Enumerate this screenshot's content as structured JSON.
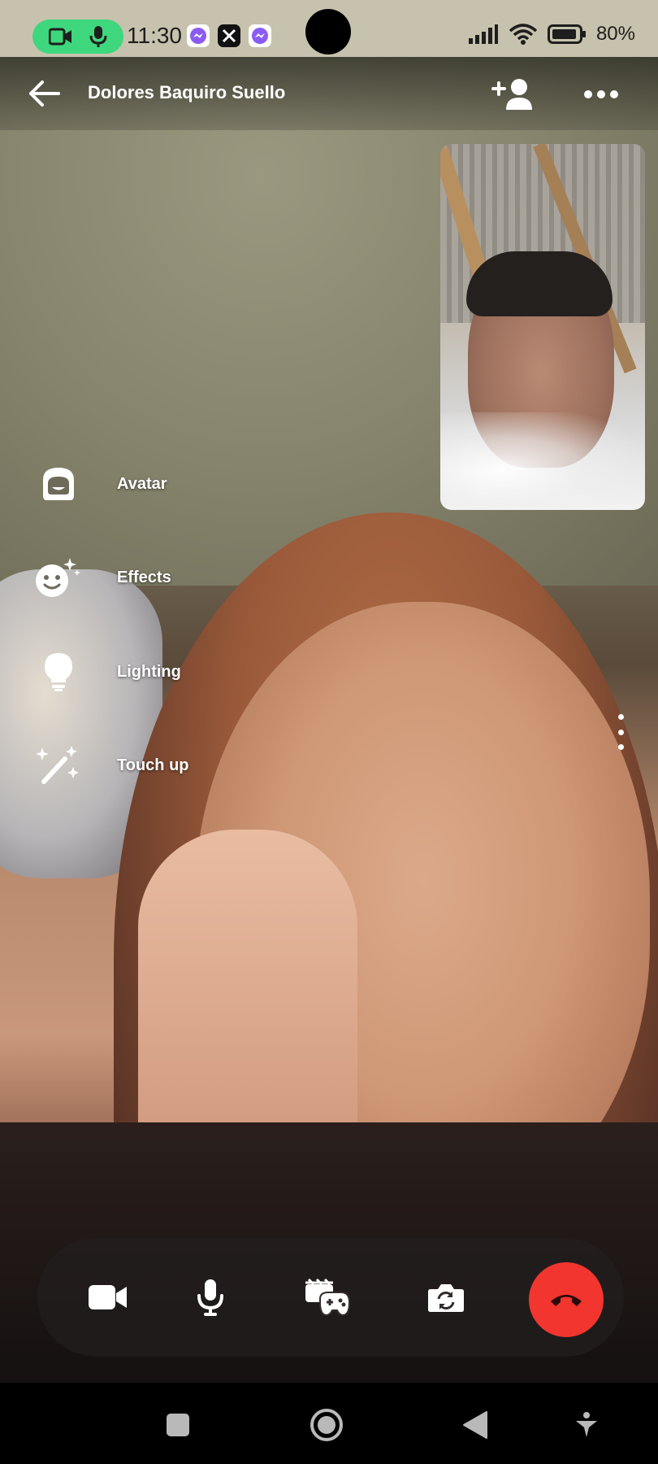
{
  "status_bar": {
    "time": "11:30",
    "battery_percent": "80%",
    "notifications": [
      "messenger-icon",
      "x-icon",
      "messenger-icon"
    ],
    "colors": {
      "recording_pill": "#3ed77d"
    }
  },
  "header": {
    "contact_name": "Dolores Baquiro Suello",
    "icons": [
      "back-arrow-icon",
      "add-person-icon",
      "more-horizontal-icon"
    ]
  },
  "effects_menu": {
    "items": [
      {
        "label": "Avatar",
        "icon": "avatar-icon"
      },
      {
        "label": "Effects",
        "icon": "effects-icon"
      },
      {
        "label": "Lighting",
        "icon": "lightbulb-icon"
      },
      {
        "label": "Touch up",
        "icon": "magic-wand-icon"
      }
    ]
  },
  "controls": {
    "icons": [
      "video-camera-icon",
      "microphone-icon",
      "games-icon",
      "flip-camera-icon",
      "end-call-icon"
    ],
    "colors": {
      "end_call": "#f2352f"
    }
  },
  "nav_bar": {
    "icons": [
      "recents-square-icon",
      "home-circle-icon",
      "back-triangle-icon",
      "accessibility-icon"
    ]
  }
}
